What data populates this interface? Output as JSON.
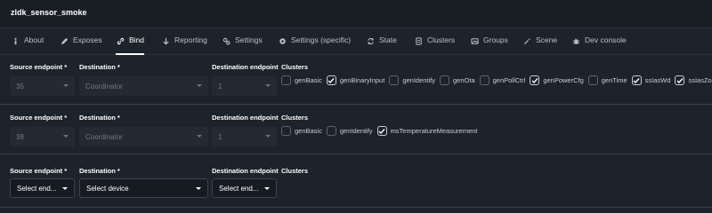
{
  "app": {
    "title": "zldk_sensor_smoke"
  },
  "tabs": [
    {
      "label": "About",
      "icon": "info-icon"
    },
    {
      "label": "Exposes",
      "icon": "pencil-icon"
    },
    {
      "label": "Bind",
      "icon": "link-icon",
      "active": true
    },
    {
      "label": "Reporting",
      "icon": "arrow-down-icon"
    },
    {
      "label": "Settings",
      "icon": "cogs-icon"
    },
    {
      "label": "Settings (specific)",
      "icon": "gear-icon"
    },
    {
      "label": "State",
      "icon": "sync-icon"
    },
    {
      "label": "Clusters",
      "icon": "document-icon"
    },
    {
      "label": "Groups",
      "icon": "image-icon"
    },
    {
      "label": "Scene",
      "icon": "magic-icon"
    },
    {
      "label": "Dev console",
      "icon": "bug-icon"
    }
  ],
  "labels": {
    "source_endpoint": "Source endpoint *",
    "destination": "Destination *",
    "destination_endpoint": "Destination endpoint",
    "clusters": "Clusters"
  },
  "bindings": [
    {
      "source_endpoint": "35",
      "destination": "Coordinator",
      "destination_endpoint": "1",
      "clusters": [
        {
          "name": "genBasic",
          "checked": false
        },
        {
          "name": "genBinaryInput",
          "checked": true
        },
        {
          "name": "genIdentify",
          "checked": false
        },
        {
          "name": "genOta",
          "checked": false
        },
        {
          "name": "genPollCtrl",
          "checked": false
        },
        {
          "name": "genPowerCfg",
          "checked": true
        },
        {
          "name": "genTime",
          "checked": false
        },
        {
          "name": "ssIasWd",
          "checked": true
        },
        {
          "name": "ssIasZone",
          "checked": true
        }
      ]
    },
    {
      "source_endpoint": "38",
      "destination": "Coordinator",
      "destination_endpoint": "1",
      "clusters": [
        {
          "name": "genBasic",
          "checked": false
        },
        {
          "name": "genIdentify",
          "checked": false
        },
        {
          "name": "msTemperatureMeasurement",
          "checked": true
        }
      ]
    }
  ],
  "new_binding": {
    "source_endpoint_placeholder": "Select end...",
    "destination_placeholder": "Select device",
    "destination_endpoint_placeholder": "Select end..."
  },
  "colors": {
    "background": "#1d232a",
    "titlebar": "#191e24",
    "text": "#ffffff"
  }
}
